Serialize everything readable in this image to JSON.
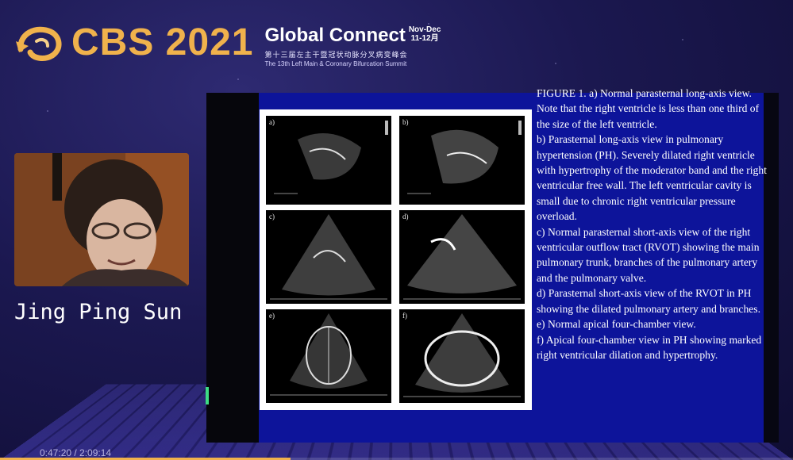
{
  "header": {
    "brand": "CBS 2021",
    "event_title": "Global Connect",
    "date_top": "Nov-Dec",
    "date_bottom": "11-12月",
    "subtitle_cn": "第十三届左主干暨冠状动脉分叉病变峰会",
    "subtitle_en": "The 13th Left Main & Coronary Bifurcation Summit",
    "brand_color": "#f0b24c"
  },
  "speaker": {
    "name": "Jing Ping Sun"
  },
  "slide": {
    "panels": [
      {
        "label": "a)"
      },
      {
        "label": "b)"
      },
      {
        "label": "c)"
      },
      {
        "label": "d)"
      },
      {
        "label": "e)"
      },
      {
        "label": "f)"
      }
    ],
    "caption": [
      "FIGURE 1. a) Normal parasternal long-axis view. Note that the right ventricle is less than one third of the size of the left ventricle.",
      "b) Parasternal long-axis view in pulmonary hypertension (PH). Severely dilated right ventricle with hypertrophy of the moderator band and the right ventricular free wall. The left ventricular cavity is small due to chronic right ventricular pressure overload.",
      "c) Normal parasternal short-axis view of the right ventricular outflow tract (RVOT) showing the main pulmonary trunk, branches of the pulmonary artery and the pulmonary valve.",
      "d) Parasternal short-axis view of the RVOT in PH showing the dilated pulmonary artery and branches.",
      "e) Normal apical four-chamber view.",
      "f) Apical four-chamber view in PH showing marked right ventricular dilation and hypertrophy."
    ]
  },
  "player": {
    "timestamp": "0:47:20 / 2:09:14",
    "progress": 0.366
  }
}
